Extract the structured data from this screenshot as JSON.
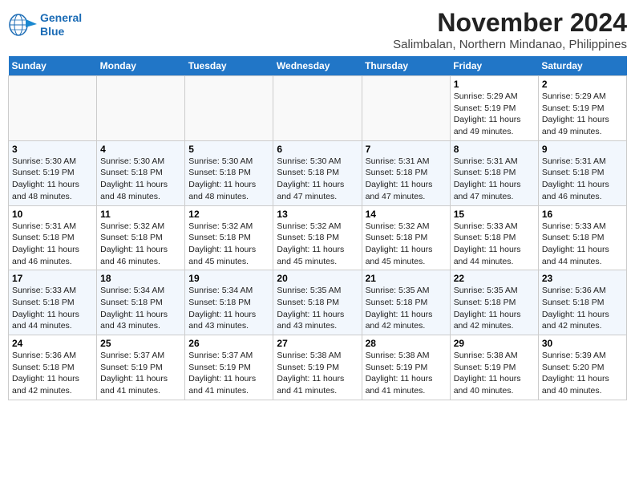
{
  "header": {
    "logo_line1": "General",
    "logo_line2": "Blue",
    "title": "November 2024",
    "subtitle": "Salimbalan, Northern Mindanao, Philippines"
  },
  "weekdays": [
    "Sunday",
    "Monday",
    "Tuesday",
    "Wednesday",
    "Thursday",
    "Friday",
    "Saturday"
  ],
  "weeks": [
    [
      {
        "day": "",
        "empty": true
      },
      {
        "day": "",
        "empty": true
      },
      {
        "day": "",
        "empty": true
      },
      {
        "day": "",
        "empty": true
      },
      {
        "day": "",
        "empty": true
      },
      {
        "day": "1",
        "sunrise": "5:29 AM",
        "sunset": "5:19 PM",
        "daylight": "11 hours and 49 minutes."
      },
      {
        "day": "2",
        "sunrise": "5:29 AM",
        "sunset": "5:19 PM",
        "daylight": "11 hours and 49 minutes."
      }
    ],
    [
      {
        "day": "3",
        "sunrise": "5:30 AM",
        "sunset": "5:19 PM",
        "daylight": "11 hours and 48 minutes."
      },
      {
        "day": "4",
        "sunrise": "5:30 AM",
        "sunset": "5:18 PM",
        "daylight": "11 hours and 48 minutes."
      },
      {
        "day": "5",
        "sunrise": "5:30 AM",
        "sunset": "5:18 PM",
        "daylight": "11 hours and 48 minutes."
      },
      {
        "day": "6",
        "sunrise": "5:30 AM",
        "sunset": "5:18 PM",
        "daylight": "11 hours and 47 minutes."
      },
      {
        "day": "7",
        "sunrise": "5:31 AM",
        "sunset": "5:18 PM",
        "daylight": "11 hours and 47 minutes."
      },
      {
        "day": "8",
        "sunrise": "5:31 AM",
        "sunset": "5:18 PM",
        "daylight": "11 hours and 47 minutes."
      },
      {
        "day": "9",
        "sunrise": "5:31 AM",
        "sunset": "5:18 PM",
        "daylight": "11 hours and 46 minutes."
      }
    ],
    [
      {
        "day": "10",
        "sunrise": "5:31 AM",
        "sunset": "5:18 PM",
        "daylight": "11 hours and 46 minutes."
      },
      {
        "day": "11",
        "sunrise": "5:32 AM",
        "sunset": "5:18 PM",
        "daylight": "11 hours and 46 minutes."
      },
      {
        "day": "12",
        "sunrise": "5:32 AM",
        "sunset": "5:18 PM",
        "daylight": "11 hours and 45 minutes."
      },
      {
        "day": "13",
        "sunrise": "5:32 AM",
        "sunset": "5:18 PM",
        "daylight": "11 hours and 45 minutes."
      },
      {
        "day": "14",
        "sunrise": "5:32 AM",
        "sunset": "5:18 PM",
        "daylight": "11 hours and 45 minutes."
      },
      {
        "day": "15",
        "sunrise": "5:33 AM",
        "sunset": "5:18 PM",
        "daylight": "11 hours and 44 minutes."
      },
      {
        "day": "16",
        "sunrise": "5:33 AM",
        "sunset": "5:18 PM",
        "daylight": "11 hours and 44 minutes."
      }
    ],
    [
      {
        "day": "17",
        "sunrise": "5:33 AM",
        "sunset": "5:18 PM",
        "daylight": "11 hours and 44 minutes."
      },
      {
        "day": "18",
        "sunrise": "5:34 AM",
        "sunset": "5:18 PM",
        "daylight": "11 hours and 43 minutes."
      },
      {
        "day": "19",
        "sunrise": "5:34 AM",
        "sunset": "5:18 PM",
        "daylight": "11 hours and 43 minutes."
      },
      {
        "day": "20",
        "sunrise": "5:35 AM",
        "sunset": "5:18 PM",
        "daylight": "11 hours and 43 minutes."
      },
      {
        "day": "21",
        "sunrise": "5:35 AM",
        "sunset": "5:18 PM",
        "daylight": "11 hours and 42 minutes."
      },
      {
        "day": "22",
        "sunrise": "5:35 AM",
        "sunset": "5:18 PM",
        "daylight": "11 hours and 42 minutes."
      },
      {
        "day": "23",
        "sunrise": "5:36 AM",
        "sunset": "5:18 PM",
        "daylight": "11 hours and 42 minutes."
      }
    ],
    [
      {
        "day": "24",
        "sunrise": "5:36 AM",
        "sunset": "5:18 PM",
        "daylight": "11 hours and 42 minutes."
      },
      {
        "day": "25",
        "sunrise": "5:37 AM",
        "sunset": "5:19 PM",
        "daylight": "11 hours and 41 minutes."
      },
      {
        "day": "26",
        "sunrise": "5:37 AM",
        "sunset": "5:19 PM",
        "daylight": "11 hours and 41 minutes."
      },
      {
        "day": "27",
        "sunrise": "5:38 AM",
        "sunset": "5:19 PM",
        "daylight": "11 hours and 41 minutes."
      },
      {
        "day": "28",
        "sunrise": "5:38 AM",
        "sunset": "5:19 PM",
        "daylight": "11 hours and 41 minutes."
      },
      {
        "day": "29",
        "sunrise": "5:38 AM",
        "sunset": "5:19 PM",
        "daylight": "11 hours and 40 minutes."
      },
      {
        "day": "30",
        "sunrise": "5:39 AM",
        "sunset": "5:20 PM",
        "daylight": "11 hours and 40 minutes."
      }
    ]
  ]
}
